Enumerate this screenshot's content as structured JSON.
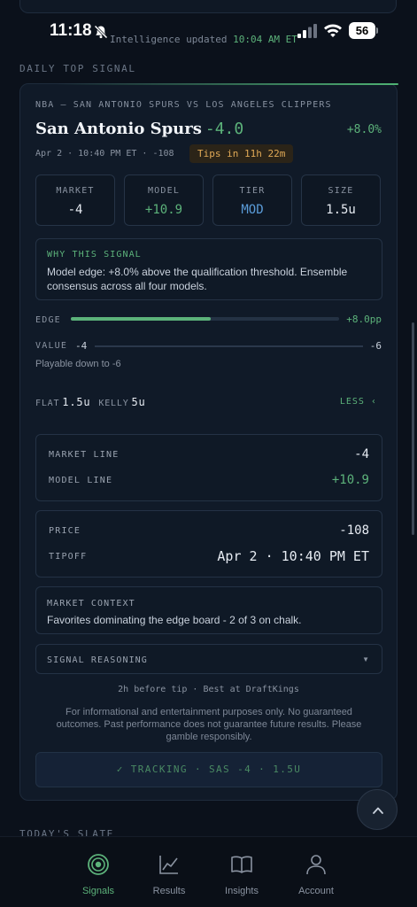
{
  "status_bar": {
    "time": "11:18",
    "updated_prefix": "Intelligence updated",
    "updated_time": "10:04 AM ET",
    "battery": "56"
  },
  "sections": {
    "daily_top_signal": "DAILY TOP SIGNAL",
    "todays_slate": "TODAY'S SLATE"
  },
  "signal": {
    "matchup": "NBA — SAN ANTONIO SPURS VS LOS ANGELES CLIPPERS",
    "team": "San Antonio Spurs",
    "spread": "-4.0",
    "edge_pct": "+8.0%",
    "meta": "Apr 2 · 10:40 PM ET · -108",
    "tips_in": "Tips in 11h 22m",
    "stats": [
      {
        "label": "MARKET",
        "value": "-4",
        "color": "#e6ebf2"
      },
      {
        "label": "MODEL",
        "value": "+10.9",
        "color": "#5cb27a"
      },
      {
        "label": "TIER",
        "value": "MOD",
        "color": "#5a9bd8"
      },
      {
        "label": "SIZE",
        "value": "1.5u",
        "color": "#e6ebf2"
      }
    ],
    "why_title": "WHY THIS SIGNAL",
    "why_text": "Model edge: +8.0% above the qualification threshold. Ensemble consensus across all four models.",
    "edge_label": "EDGE",
    "edge_value": "+8.0pp",
    "edge_fill_fraction": 0.52,
    "value_label": "VALUE",
    "value_low": "-4",
    "value_high": "-6",
    "playable": "Playable down to -6",
    "flat_label": "FLAT",
    "flat_value": "1.5u",
    "kelly_label": "KELLY",
    "kelly_value": "5u",
    "less_label": "LESS",
    "lines": {
      "market_label": "MARKET LINE",
      "market_value": "-4",
      "model_label": "MODEL LINE",
      "model_value": "+10.9"
    },
    "price": {
      "price_label": "PRICE",
      "price_value": "-108",
      "tipoff_label": "TIPOFF",
      "tipoff_value": "Apr 2 · 10:40 PM ET"
    },
    "context_title": "MARKET CONTEXT",
    "context_text": "Favorites dominating the edge board - 2 of 3 on chalk.",
    "reasoning_label": "SIGNAL REASONING",
    "best_at": "2h before tip · Best at DraftKings",
    "disclaimer": "For informational and entertainment purposes only. No guaranteed outcomes. Past performance does not guarantee future results. Please gamble responsibly.",
    "tracking": "✓ TRACKING · SAS -4 · 1.5U"
  },
  "tabs": [
    {
      "label": "Signals",
      "icon": "target-icon",
      "active": true
    },
    {
      "label": "Results",
      "icon": "chart-line-icon",
      "active": false
    },
    {
      "label": "Insights",
      "icon": "book-icon",
      "active": false
    },
    {
      "label": "Account",
      "icon": "person-icon",
      "active": false
    }
  ],
  "colors": {
    "accent": "#5cb27a",
    "tier": "#5a9bd8",
    "warning": "#e0a956",
    "background": "#0b111b",
    "card": "#101a28"
  }
}
